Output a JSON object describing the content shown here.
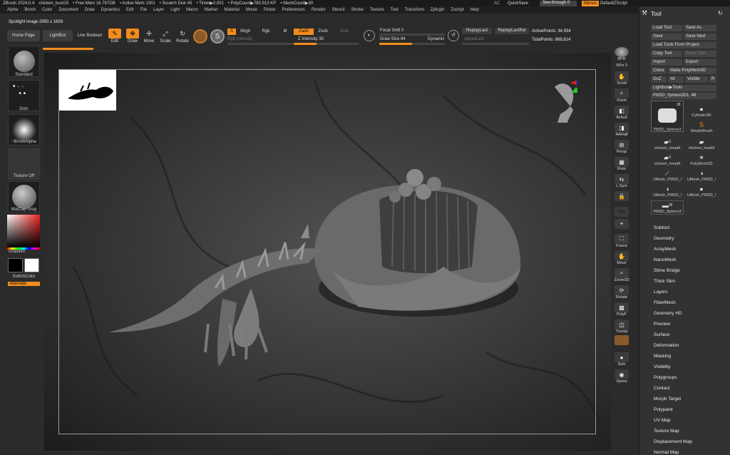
{
  "titlebar": {
    "app": "ZBrush 2024.0.4",
    "doc": "chicken_bust15",
    "free_mem": "• Free Mem 16.767GB",
    "active_mem": "• Active Mem 1001",
    "scratch": "• Scratch Disk 45",
    "timer": "• Timer▶0.001",
    "polycount": "• PolyCount▶780.913 KP",
    "meshcount": "• MeshCount▶30",
    "ac": "AC",
    "quicksave": "QuickSave",
    "seethrough": "See-through 0",
    "menus": "Menus",
    "defaultzscript": "DefaultZScript"
  },
  "menu": [
    "Alpha",
    "Brush",
    "Color",
    "Document",
    "Draw",
    "Dynamics",
    "Edit",
    "File",
    "Layer",
    "Light",
    "Macro",
    "Marker",
    "Material",
    "Movie",
    "Picker",
    "Preferences",
    "Render",
    "Stencil",
    "Stroke",
    "Texture",
    "Tool",
    "Transform",
    "Zplugin",
    "Zscript",
    "Help"
  ],
  "spotlight": "Spotlight image 2950 x 1659",
  "toolbar": {
    "home_page": "Home Page",
    "lightbox": "LightBox",
    "live_boolean": "Live Boolean",
    "edit": "Edit",
    "draw": "Draw",
    "move": "Move",
    "scale": "Scale",
    "rotate": "Rotate",
    "a": "A",
    "mrgb": "Mrgb",
    "rgb": "Rgb",
    "m": "M",
    "zadd": "Zadd",
    "zsub": "Zsub",
    "zcut": "Zcut",
    "rgb_intensity": "Rgb Intensity",
    "z_intensity": "Z Intensity 35",
    "focal_shift": "Focal Shift 0",
    "draw_size": "Draw Size 64",
    "dynamic": "Dynamic",
    "replaylast": "ReplayLast",
    "replaylastrel": "ReplayLastRel",
    "adjustlast": "AdjustLast",
    "active_points": "ActivePoints: 34,934",
    "total_points": "TotalPoints: 868,814",
    "z_intensity_level": 0.35,
    "draw_size_level": 0.5
  },
  "leftshelf": {
    "standard": "Standard",
    "dots": "Dots",
    "brushalpha": "~BrushAlpha",
    "texture_off": "Texture Off",
    "matcap_gray": "MatCap Gray",
    "gradient": "Gradient",
    "switchcolor": "SwitchColor",
    "alternate": "Alternate"
  },
  "rightnav": [
    "BPR",
    "SPix 3",
    "Scroll",
    "Zoom",
    "Actual",
    "AAHalf",
    "Persp",
    "Floor",
    "L.Sym",
    "Qxyz",
    "",
    "Frame",
    "Move",
    "Zoom3D",
    "Rotate",
    "PolyF",
    "Transp",
    "Ghost",
    "Solo",
    "Xpose"
  ],
  "panel": {
    "title": "Tool",
    "load_tool": "Load Tool",
    "save_as": "Save As",
    "save": "Save",
    "save_next": "Save Next",
    "load_from_project": "Load Tools From Project",
    "copy_tool": "Copy Tool",
    "paste_tool": "Paste Tool",
    "import": "Import",
    "export": "Export",
    "clone": "Clone",
    "make_polymesh": "Make PolyMesh3D",
    "goz": "GoZ",
    "all": "All",
    "visible": "Visible",
    "r": "R",
    "lightbox_tools": "Lightbox▶Tools",
    "current_tool": "PM3D_Sphere3D1. 48",
    "tools": [
      {
        "label": "PM3D_Sphere3",
        "badge": "38"
      },
      {
        "label": "Cylinder3D",
        "badge": ""
      },
      {
        "label": "SimpleBrush",
        "badge": ""
      },
      {
        "label": "chicken_head4",
        "badge": "3"
      },
      {
        "label": "chicken_head4",
        "badge": ""
      },
      {
        "label": "chicken_head4",
        "badge": "3"
      },
      {
        "label": "PolyMesh3D",
        "badge": ""
      },
      {
        "label": "UMesh_PM3D_!",
        "badge": ""
      },
      {
        "label": "UMesh_PM3D_!",
        "badge": ""
      },
      {
        "label": "UMesh_PM3D_!",
        "badge": ""
      },
      {
        "label": "UMesh_PM3D_!",
        "badge": ""
      },
      {
        "label": "PM3D_Sphere3",
        "badge": "38"
      }
    ],
    "sections": [
      "Subtool",
      "Geometry",
      "ArrayMesh",
      "NanoMesh",
      "Slime Bridge",
      "Thick Skin",
      "Layers",
      "FiberMesh",
      "Geometry HD",
      "Preview",
      "Surface",
      "Deformation",
      "Masking",
      "Visibility",
      "Polygroups",
      "Contact",
      "Morph Target",
      "Polypaint",
      "UV Map",
      "Texture Map",
      "Displacement Map",
      "Normal Map"
    ]
  }
}
